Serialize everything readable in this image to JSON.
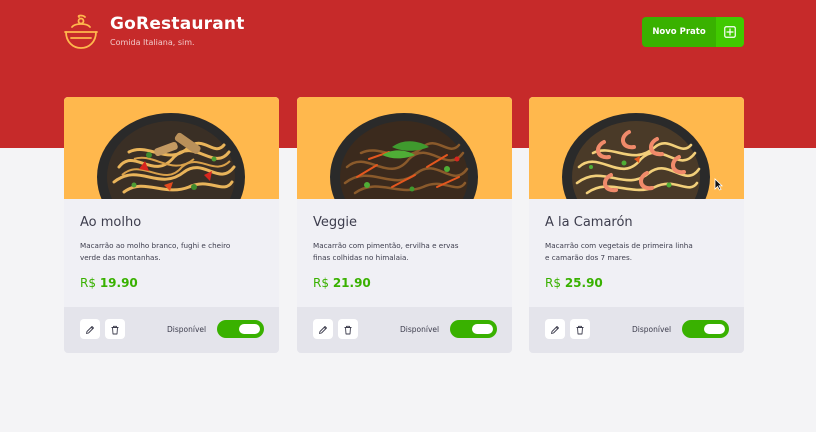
{
  "header": {
    "title": "GoRestaurant",
    "subtitle": "Comida Italiana, sim.",
    "logo_icon": "food-bowl-icon",
    "new_button_label": "Novo Prato",
    "new_button_icon": "plus-square-icon"
  },
  "colors": {
    "header_bg": "#c62a2a",
    "accent_green": "#39b100",
    "card_image_bg": "#ffb84d",
    "text_dark": "#3d3d4d"
  },
  "cards": [
    {
      "name": "Ao molho",
      "description_line1": "Macarrão ao molho branco, fughi e cheiro",
      "description_line2": "verde das montanhas.",
      "currency": "R$",
      "price": "19.90",
      "available_label": "Disponível",
      "available": true
    },
    {
      "name": "Veggie",
      "description_line1": "Macarrão com pimentão, ervilha e ervas",
      "description_line2": "finas colhidas no himalaia.",
      "currency": "R$",
      "price": "21.90",
      "available_label": "Disponível",
      "available": true
    },
    {
      "name": "A la Camarón",
      "description_line1": "Macarrão com vegetais de primeira linha",
      "description_line2": "e camarão dos 7 mares.",
      "currency": "R$",
      "price": "25.90",
      "available_label": "Disponível",
      "available": true
    }
  ],
  "card_actions": {
    "edit_icon": "pencil-icon",
    "delete_icon": "trash-icon"
  }
}
